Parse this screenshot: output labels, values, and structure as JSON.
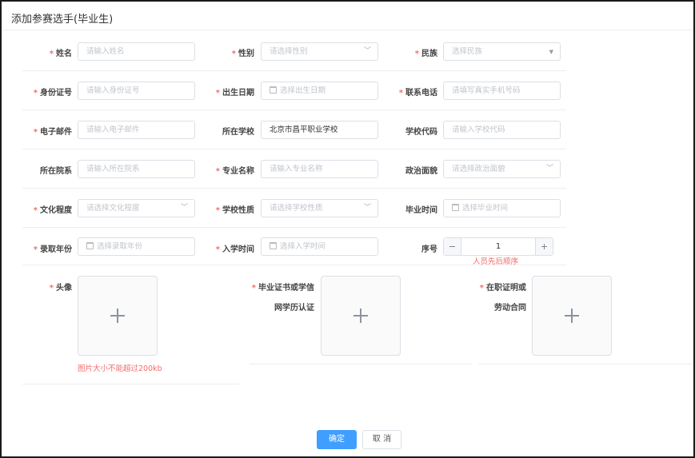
{
  "dialog": {
    "title": "添加参赛选手(毕业生)"
  },
  "fields": {
    "name": {
      "label": "姓名",
      "placeholder": "请输入姓名"
    },
    "gender": {
      "label": "性别",
      "placeholder": "请选择性别"
    },
    "ethnicity": {
      "label": "民族",
      "placeholder": "选择民族"
    },
    "id_number": {
      "label": "身份证号",
      "placeholder": "请输入身份证号"
    },
    "birth_date": {
      "label": "出生日期",
      "placeholder": "选择出生日期"
    },
    "phone": {
      "label": "联系电话",
      "placeholder": "请填写真实手机号码"
    },
    "email": {
      "label": "电子邮件",
      "placeholder": "请输入电子邮件"
    },
    "school": {
      "label": "所在学校",
      "value": "北京市昌平职业学校"
    },
    "school_code": {
      "label": "学校代码",
      "placeholder": "请输入学校代码"
    },
    "department": {
      "label": "所在院系",
      "placeholder": "请输入所在院系"
    },
    "major": {
      "label": "专业名称",
      "placeholder": "请输入专业名称"
    },
    "political_status": {
      "label": "政治面貌",
      "placeholder": "请选择政治面貌"
    },
    "education": {
      "label": "文化程度",
      "placeholder": "请选择文化程度"
    },
    "school_type": {
      "label": "学校性质",
      "placeholder": "请选择学校性质"
    },
    "graduation_time": {
      "label": "毕业时间",
      "placeholder": "选择毕业时间"
    },
    "admission_year": {
      "label": "录取年份",
      "placeholder": "选择录取年份"
    },
    "enrollment_time": {
      "label": "入学时间",
      "placeholder": "选择入学时间"
    },
    "sequence": {
      "label": "序号",
      "value": "1",
      "hint": "人员先后顺序"
    }
  },
  "uploads": {
    "avatar": {
      "label": "头像",
      "hint": "图片大小不能超过200kb"
    },
    "certificate": {
      "label_line1": "毕业证书或学信",
      "label_line2": "网学历认证"
    },
    "employment": {
      "label_line1": "在职证明或",
      "label_line2": "劳动合同"
    }
  },
  "footer": {
    "confirm_label": "确定",
    "cancel_label": "取 消"
  },
  "icons": {
    "calendar": "calendar-icon",
    "chevron": "chevron-down-icon",
    "plus": "plus-icon",
    "minus": "minus-icon"
  },
  "colors": {
    "primary": "#409eff",
    "required": "#f56c6c",
    "border": "#dcdfe6"
  }
}
